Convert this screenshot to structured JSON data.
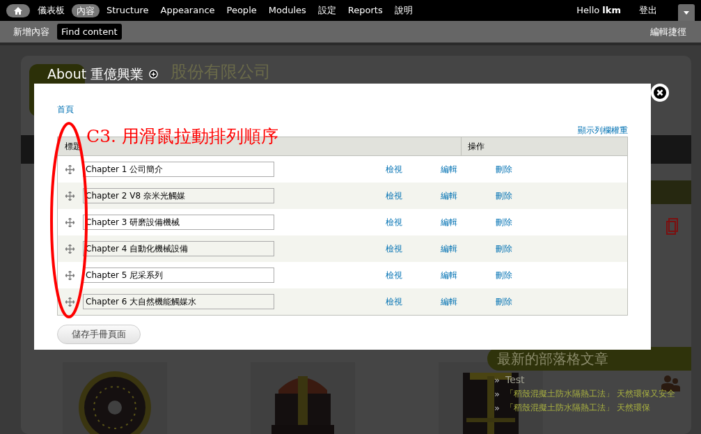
{
  "toolbar": {
    "menu": [
      {
        "label": "儀表板",
        "selected": false
      },
      {
        "label": "內容",
        "selected": true
      },
      {
        "label": "Structure",
        "selected": false
      },
      {
        "label": "Appearance",
        "selected": false
      },
      {
        "label": "People",
        "selected": false
      },
      {
        "label": "Modules",
        "selected": false
      },
      {
        "label": "設定",
        "selected": false
      },
      {
        "label": "Reports",
        "selected": false
      },
      {
        "label": "說明",
        "selected": false
      }
    ],
    "greeting": "Hello",
    "user_name": "lkm",
    "logout": "登出"
  },
  "shortcuts": {
    "items": [
      {
        "label": "新增內容",
        "selected": false
      },
      {
        "label": "Find content",
        "selected": true
      }
    ],
    "edit_shortcuts": "編輯捷徑"
  },
  "site": {
    "name_visible": "股份有限公司",
    "sidebar_title": "最新的部落格文章",
    "posts": [
      {
        "bullet": "»",
        "text": "Test"
      },
      {
        "bullet": "»",
        "text": "「稻殼混擬土防水隔熱工法」 天然環保又安全"
      },
      {
        "bullet": "»",
        "text": "「稻殼混擬土防水隔熱工法」 天然環保"
      }
    ]
  },
  "modal": {
    "title": "About 重億興業",
    "breadcrumb": "首頁",
    "weights_link": "顯示列欄權重",
    "columns": [
      "標題",
      "操作"
    ],
    "rows": [
      {
        "title": "Chapter 1 公司簡介",
        "actions": [
          "檢視",
          "編輯",
          "刪除"
        ]
      },
      {
        "title": "Chapter 2 V8 奈米光觸媒",
        "actions": [
          "檢視",
          "編輯",
          "刪除"
        ]
      },
      {
        "title": "Chapter 3 研磨設備機械",
        "actions": [
          "檢視",
          "編輯",
          "刪除"
        ]
      },
      {
        "title": "Chapter 4 自動化機械設備",
        "actions": [
          "檢視",
          "編輯",
          "刪除"
        ]
      },
      {
        "title": "Chapter 5 尼采系列",
        "actions": [
          "檢視",
          "編輯",
          "刪除"
        ]
      },
      {
        "title": "Chapter 6 大自然機能觸媒水",
        "actions": [
          "檢視",
          "編輯",
          "刪除"
        ]
      }
    ],
    "save_button": "儲存手冊頁面",
    "annotation": "C3. 用滑鼠拉動排列順序"
  }
}
